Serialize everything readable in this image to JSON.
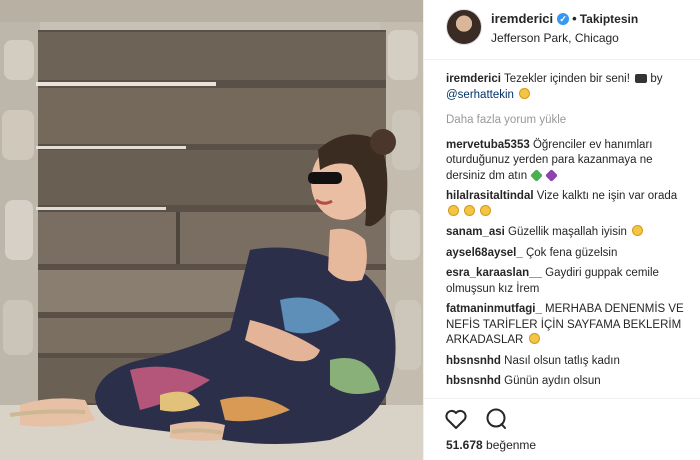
{
  "header": {
    "username": "iremderici",
    "follow_label": "Takiptesin",
    "location": "Jefferson Park, Chicago"
  },
  "caption": {
    "username": "iremderici",
    "text": "Tezekler içinden bir seni!",
    "by_text": "by",
    "mention": "@serhattekin"
  },
  "load_more_label": "Daha fazla yorum yükle",
  "comments": [
    {
      "user": "mervetuba5353",
      "text": "Öğrenciler ev hanımları oturduğunuz yerden para kazanmaya ne dersiniz dm atın"
    },
    {
      "user": "hilalrasitaltindal",
      "text": "Vize kalktı ne işin var orada"
    },
    {
      "user": "sanam_asi",
      "text": "Güzellik maşallah iyisin"
    },
    {
      "user": "aysel68aysel_",
      "text": "Çok fena güzelsin"
    },
    {
      "user": "esra_karaaslan__",
      "text": "Gaydiri guppak cemile olmuşsun kız İrem"
    },
    {
      "user": "fatmaninmutfagi_",
      "text": "MERHABA DENENMİS VE NEFİS TARİFLER İÇİN SAYFAMA BEKLERİM ARKADASLAR"
    },
    {
      "user": "hbsnsnhd",
      "text": "Nasıl olsun tatlış kadın"
    },
    {
      "user": "hbsnsnhd",
      "text": "Günün aydın olsun"
    }
  ],
  "likes": {
    "count": "51.678",
    "label": "beğenme"
  },
  "icons": {
    "verified": "verified-badge-icon",
    "like": "heart-icon",
    "comment": "comment-bubble-icon"
  },
  "colors": {
    "link": "#003569",
    "verified": "#3897f0",
    "muted": "#999999"
  }
}
